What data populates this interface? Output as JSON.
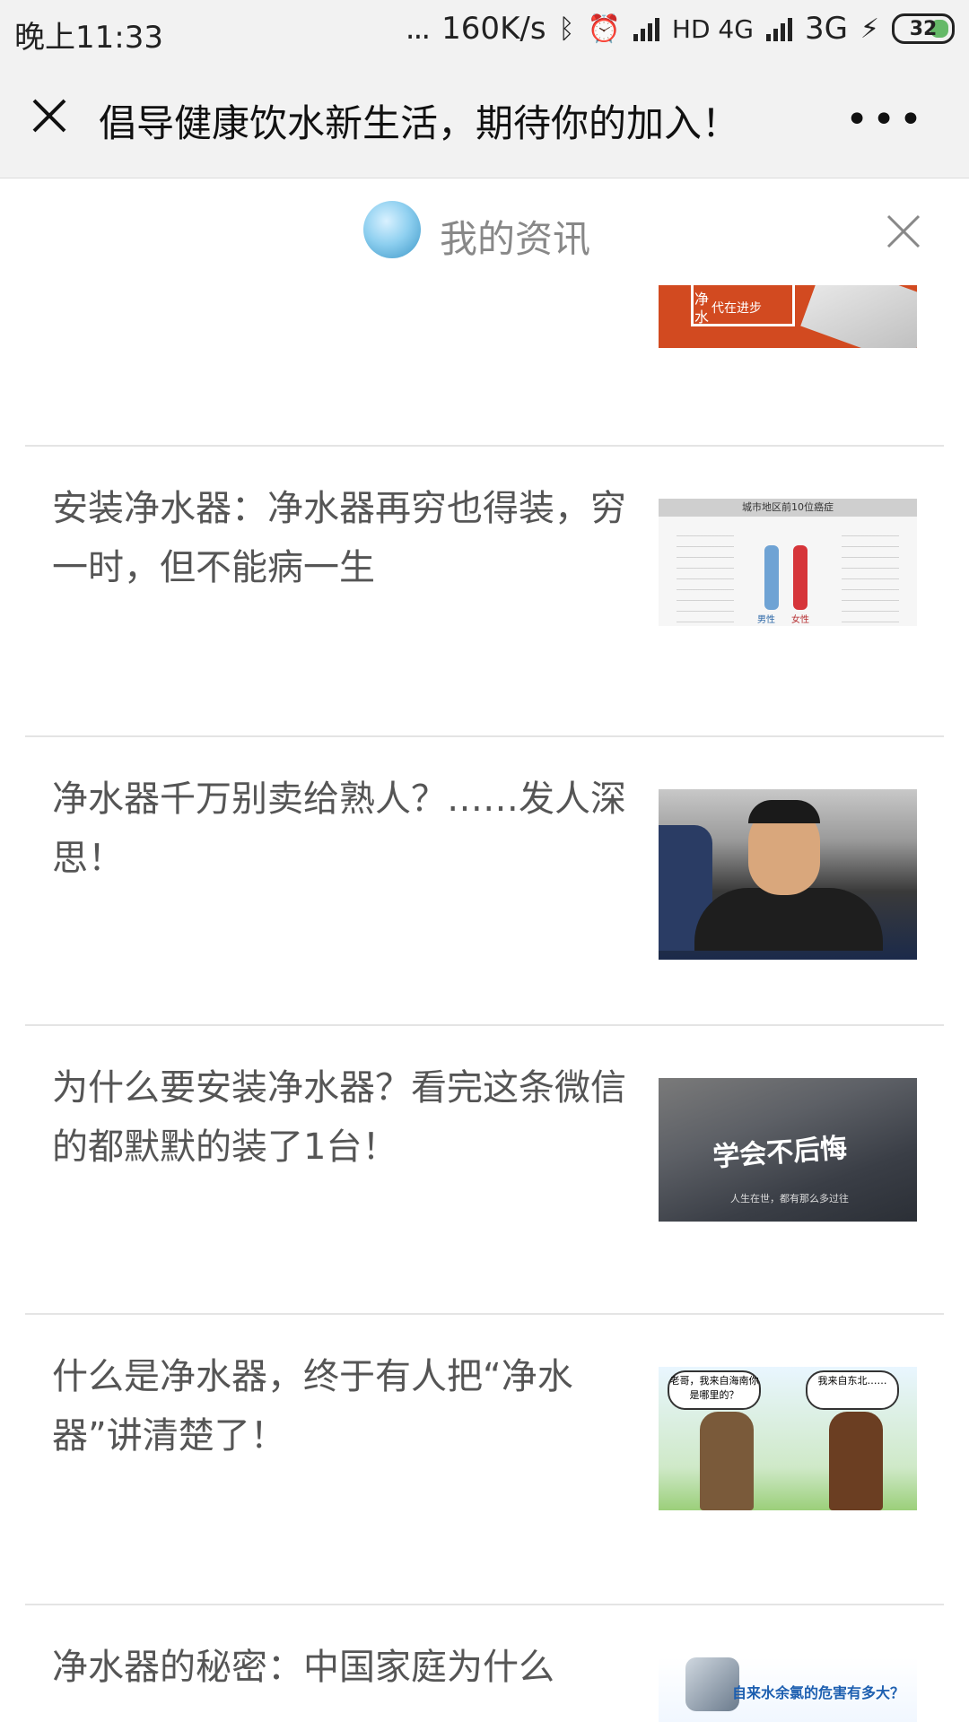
{
  "status_bar": {
    "time": "晚上11:33",
    "dots": "...",
    "speed": "160K/s",
    "network1": "HD 4G",
    "network2": "3G",
    "battery": "32",
    "icons": [
      "bluetooth-icon",
      "alarm-icon",
      "signal-icon",
      "charging-icon",
      "battery-icon"
    ]
  },
  "header": {
    "title": "倡导健康饮水新生活，期待你的加入！",
    "close_icon": "close-icon",
    "more_icon": "more-icon"
  },
  "panel": {
    "title": "我的资讯",
    "close_icon": "close-icon"
  },
  "articles": [
    {
      "title": "",
      "thumb": "orange-keyboard"
    },
    {
      "title": "安装净水器：净水器再穷也得装，穷一时，但不能病一生",
      "thumb": "chart"
    },
    {
      "title": "净水器千万别卖给熟人？……发人深思！",
      "thumb": "photo"
    },
    {
      "title": "为什么要安装净水器？看完这条微信的都默默的装了1台！",
      "thumb": "storm"
    },
    {
      "title": "什么是净水器，终于有人把“净水器”讲清楚了！",
      "thumb": "cartoon"
    },
    {
      "title": "净水器的秘密：中国家庭为什么",
      "thumb": "tap"
    }
  ],
  "thumb_text": {
    "orange_line1": "净",
    "orange_line2": "水",
    "orange_box": "代在进步",
    "chart_title": "城市地区前10位癌症",
    "chart_male": "男性",
    "chart_female": "女性",
    "storm_main": "学会不后悔",
    "storm_sub": "人生在世，都有那么多过往",
    "cartoon_left": "老哥，我来自海南你是哪里的？",
    "cartoon_right": "我来自东北……",
    "tap_caption": "自来水余氯的危害有多大？"
  }
}
